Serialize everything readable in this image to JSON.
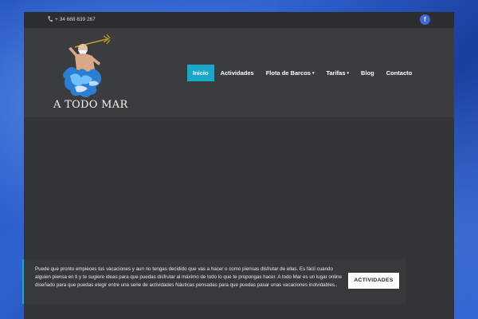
{
  "topbar": {
    "phone": "+ 34 668 839 267",
    "facebook_label": "f"
  },
  "logo": {
    "text": "A TODO MAR"
  },
  "nav": {
    "items": [
      {
        "label": "Inicio"
      },
      {
        "label": "Actividades"
      },
      {
        "label": "Flota de Barcos"
      },
      {
        "label": "Tarifas"
      },
      {
        "label": "Blog"
      },
      {
        "label": "Contacto"
      }
    ],
    "caret": "▾"
  },
  "cookie": {
    "text": "Puede que pronto empieces tus vacaciones y aun no tengas decidido que vas a hacer o como piensas disfrutar de ellas. Es fácil cuando alguien piensa en ti y te sugiere ideas para que puedas disfrutar al máximo de todo lo que te propongas hacer. A todo Mar es un lugar online diseñado para que puedas elegir entre una serie de actividades Náuticas pensadas para que puedas pasar unas vacaciones inolvidables..",
    "button": "ACTIVIDADES"
  },
  "colors": {
    "accent": "#1aa7c9",
    "facebook": "#3d6ad6",
    "page_bg": "#323436"
  }
}
